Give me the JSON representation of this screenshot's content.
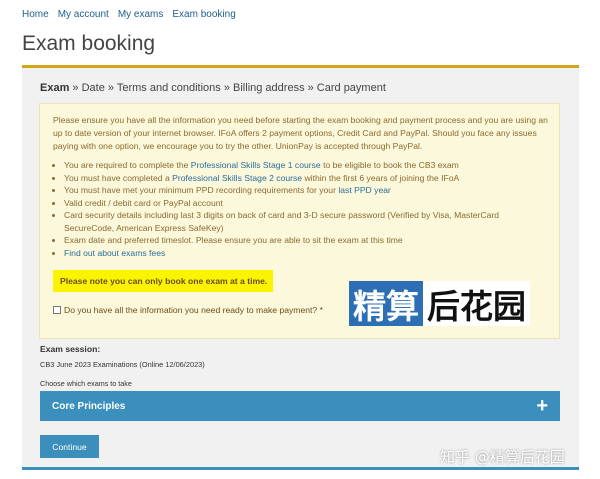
{
  "topnav": {
    "items": [
      "Home",
      "My account",
      "My exams",
      "Exam booking"
    ]
  },
  "page": {
    "title": "Exam booking"
  },
  "steps": {
    "current": "Exam",
    "rest": " » Date » Terms and conditions » Billing address » Card payment"
  },
  "info": {
    "intro": "Please ensure you have all the information you need before starting the exam booking and payment process and you are using an up to date version of your internet browser. IFoA offers 2 payment options, Credit Card and PayPal. Should you face any issues paying with one option, we encourage you to try the other. UnionPay is accepted through PayPal.",
    "req1_a": "You are required to complete the ",
    "req1_link": "Professional Skills Stage 1 course",
    "req1_b": " to be eligible to book the CB3 exam",
    "req2_a": "You must have completed a ",
    "req2_link": "Professional Skills Stage 2 course",
    "req2_b": " within the first 6 years of joining the IFoA",
    "req3_a": "You must have met your minimum PPD recording requirements for your ",
    "req3_link": "last PPD year",
    "req4": "Valid credit / debit card or PayPal account",
    "req5": "Card security details including last 3 digits on back of card and 3-D secure password (Verified by Visa, MasterCard SecureCode, American Express SafeKey)",
    "req6": "Exam date and preferred timeslot. Please ensure you are able to sit the exam at this time",
    "req7_link": "Find out about exams fees",
    "note": "Please note you can only book one exam at a time.",
    "confirm_label": "Do you have all the information you need ready to make payment? *"
  },
  "watermark": {
    "blue": "精算",
    "white": "后花园"
  },
  "session": {
    "label": "Exam session:",
    "value": "CB3 June 2023 Examinations (Online 12/06/2023)",
    "choose_label": "Choose which exams to take"
  },
  "accordion": {
    "label": "Core Principles",
    "icon": "plus-icon",
    "color": "#3a8fbd"
  },
  "continue_label": "Continue",
  "zhihu_watermark": "知乎 @精算后花园",
  "colors": {
    "accent": "#3a8fbd",
    "gold": "#d3a51c",
    "highlight": "#fbf300",
    "link": "#1d5f8a"
  }
}
